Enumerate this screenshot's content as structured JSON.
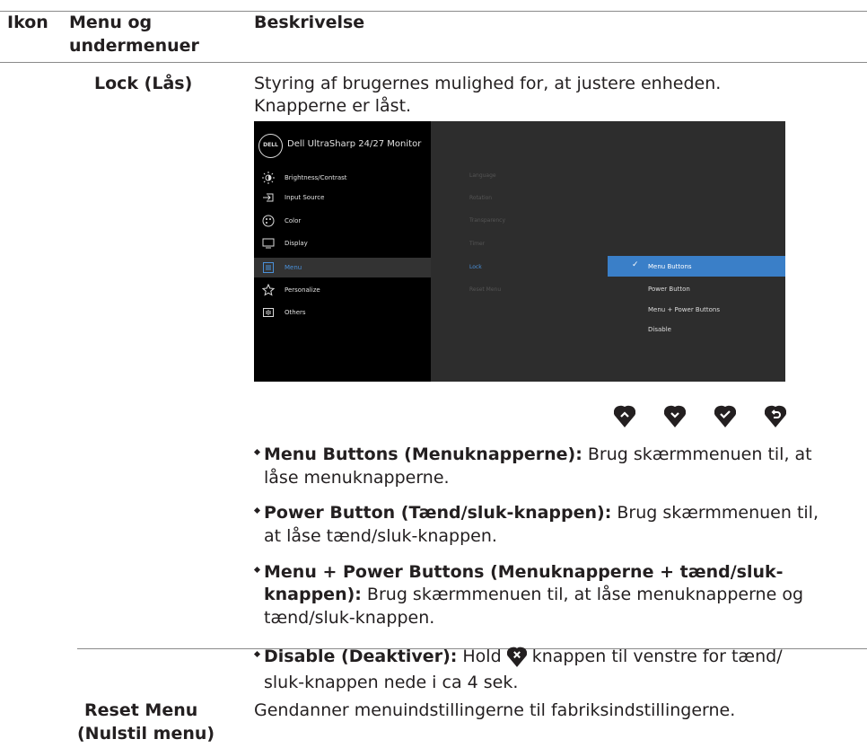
{
  "header": {
    "col1": "Ikon",
    "col2_line1": "Menu og",
    "col2_line2": "undermenuer",
    "col3": "Beskrivelse"
  },
  "lock_row": {
    "label": "Lock (Lås)",
    "desc_line1": "Styring af brugernes mulighed for, at justere enheden.",
    "desc_line2": "Knapperne er låst."
  },
  "osd": {
    "logo": "DELL",
    "title": "Dell UltraSharp 24/27 Monitor",
    "menu_items": [
      {
        "label": "Brightness/Contrast",
        "icon": "brightness-icon"
      },
      {
        "label": "Input Source",
        "icon": "input-source-icon"
      },
      {
        "label": "Color",
        "icon": "color-icon"
      },
      {
        "label": "Display",
        "icon": "display-icon"
      },
      {
        "label": "Menu",
        "icon": "menu-icon"
      },
      {
        "label": "Personalize",
        "icon": "star-icon"
      },
      {
        "label": "Others",
        "icon": "others-icon"
      }
    ],
    "sub_items": [
      "Language",
      "Rotation",
      "Transparency",
      "Timer",
      "Lock",
      "Reset Menu"
    ],
    "options": [
      "Menu Buttons",
      "Power Button",
      "Menu + Power Buttons",
      "Disable"
    ],
    "accent": "#3a7fc8"
  },
  "buttons": [
    "chevron-up-icon",
    "chevron-down-icon",
    "check-icon",
    "back-icon"
  ],
  "bullets": {
    "b1_bold": "Menu Buttons (Menuknapperne):",
    "b1_text": " Brug skærmmenuen til, at",
    "b1_line2": "låse menuknapperne.",
    "b2_bold": "Power Button (Tænd/sluk-knappen):",
    "b2_text": " Brug skærmmenuen til,",
    "b2_line2": "at låse tænd/sluk-knappen.",
    "b3_bold": "Menu + Power Buttons (Menuknapperne + tænd/sluk-",
    "b3_bold2": "knappen):",
    "b3_text": " Brug skærmmenuen til, at låse menuknapperne og",
    "b3_line3": "tænd/sluk-knappen.",
    "b4_bold": "Disable (Deaktiver):",
    "b4_text1": " Hold ",
    "b4_text2": " knappen til venstre for tænd/",
    "b4_line2": "sluk-knappen nede i ca 4 sek."
  },
  "reset_row": {
    "label_line1": "Reset Menu",
    "label_line2": "(Nulstil menu)",
    "desc": "Gendanner menuindstillingerne til fabriksindstillingerne."
  }
}
